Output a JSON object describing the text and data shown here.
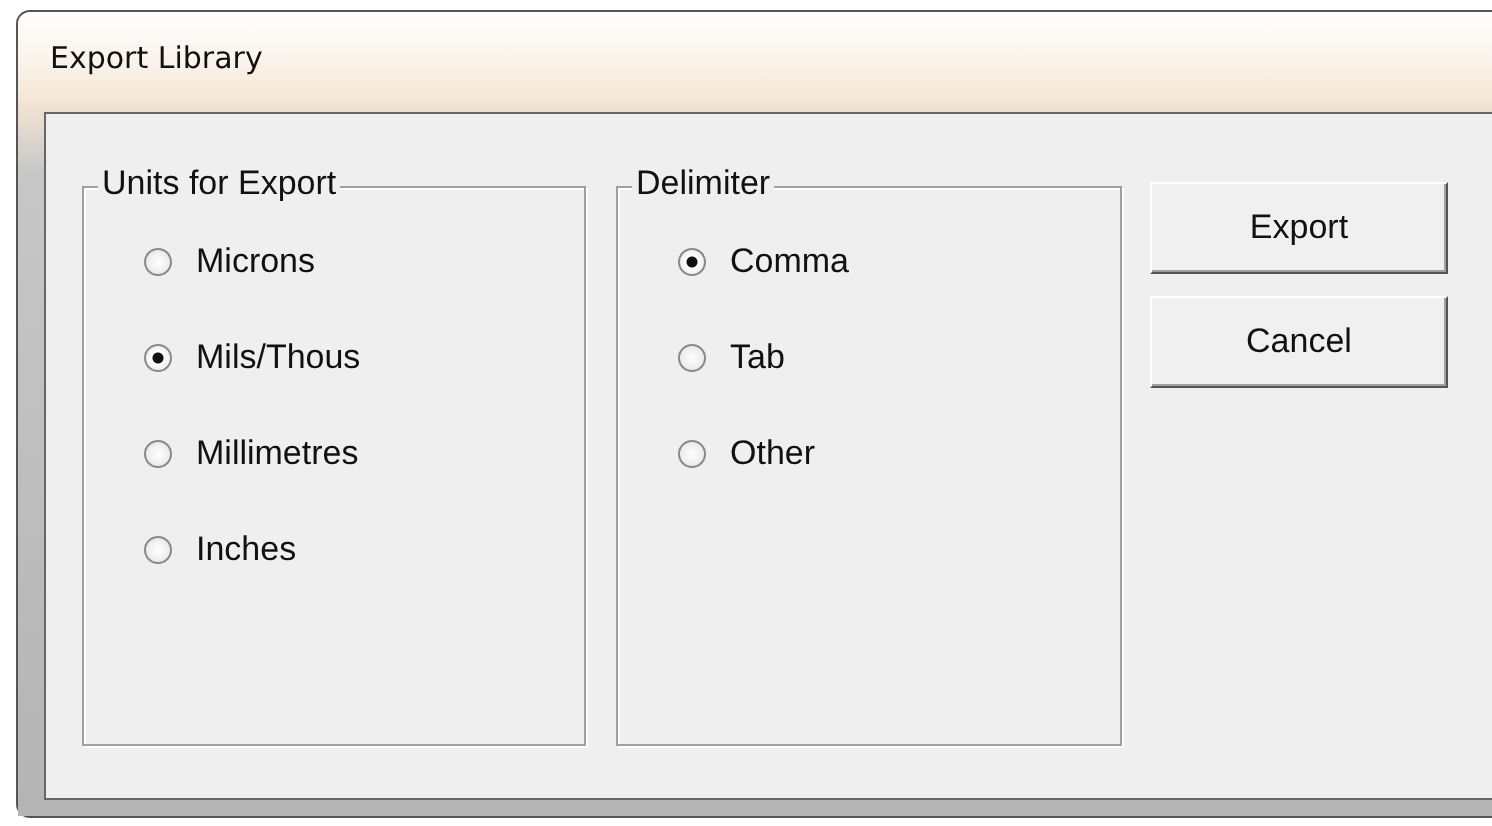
{
  "window": {
    "title": "Export Library"
  },
  "groups": [
    {
      "label": "Units for Export",
      "options": [
        {
          "label": "Microns",
          "selected": false
        },
        {
          "label": "Mils/Thous",
          "selected": true
        },
        {
          "label": "Millimetres",
          "selected": false
        },
        {
          "label": "Inches",
          "selected": false
        }
      ]
    },
    {
      "label": "Delimiter",
      "options": [
        {
          "label": "Comma",
          "selected": true
        },
        {
          "label": "Tab",
          "selected": false
        },
        {
          "label": "Other",
          "selected": false
        }
      ]
    }
  ],
  "buttons": [
    "Export",
    "Cancel"
  ]
}
